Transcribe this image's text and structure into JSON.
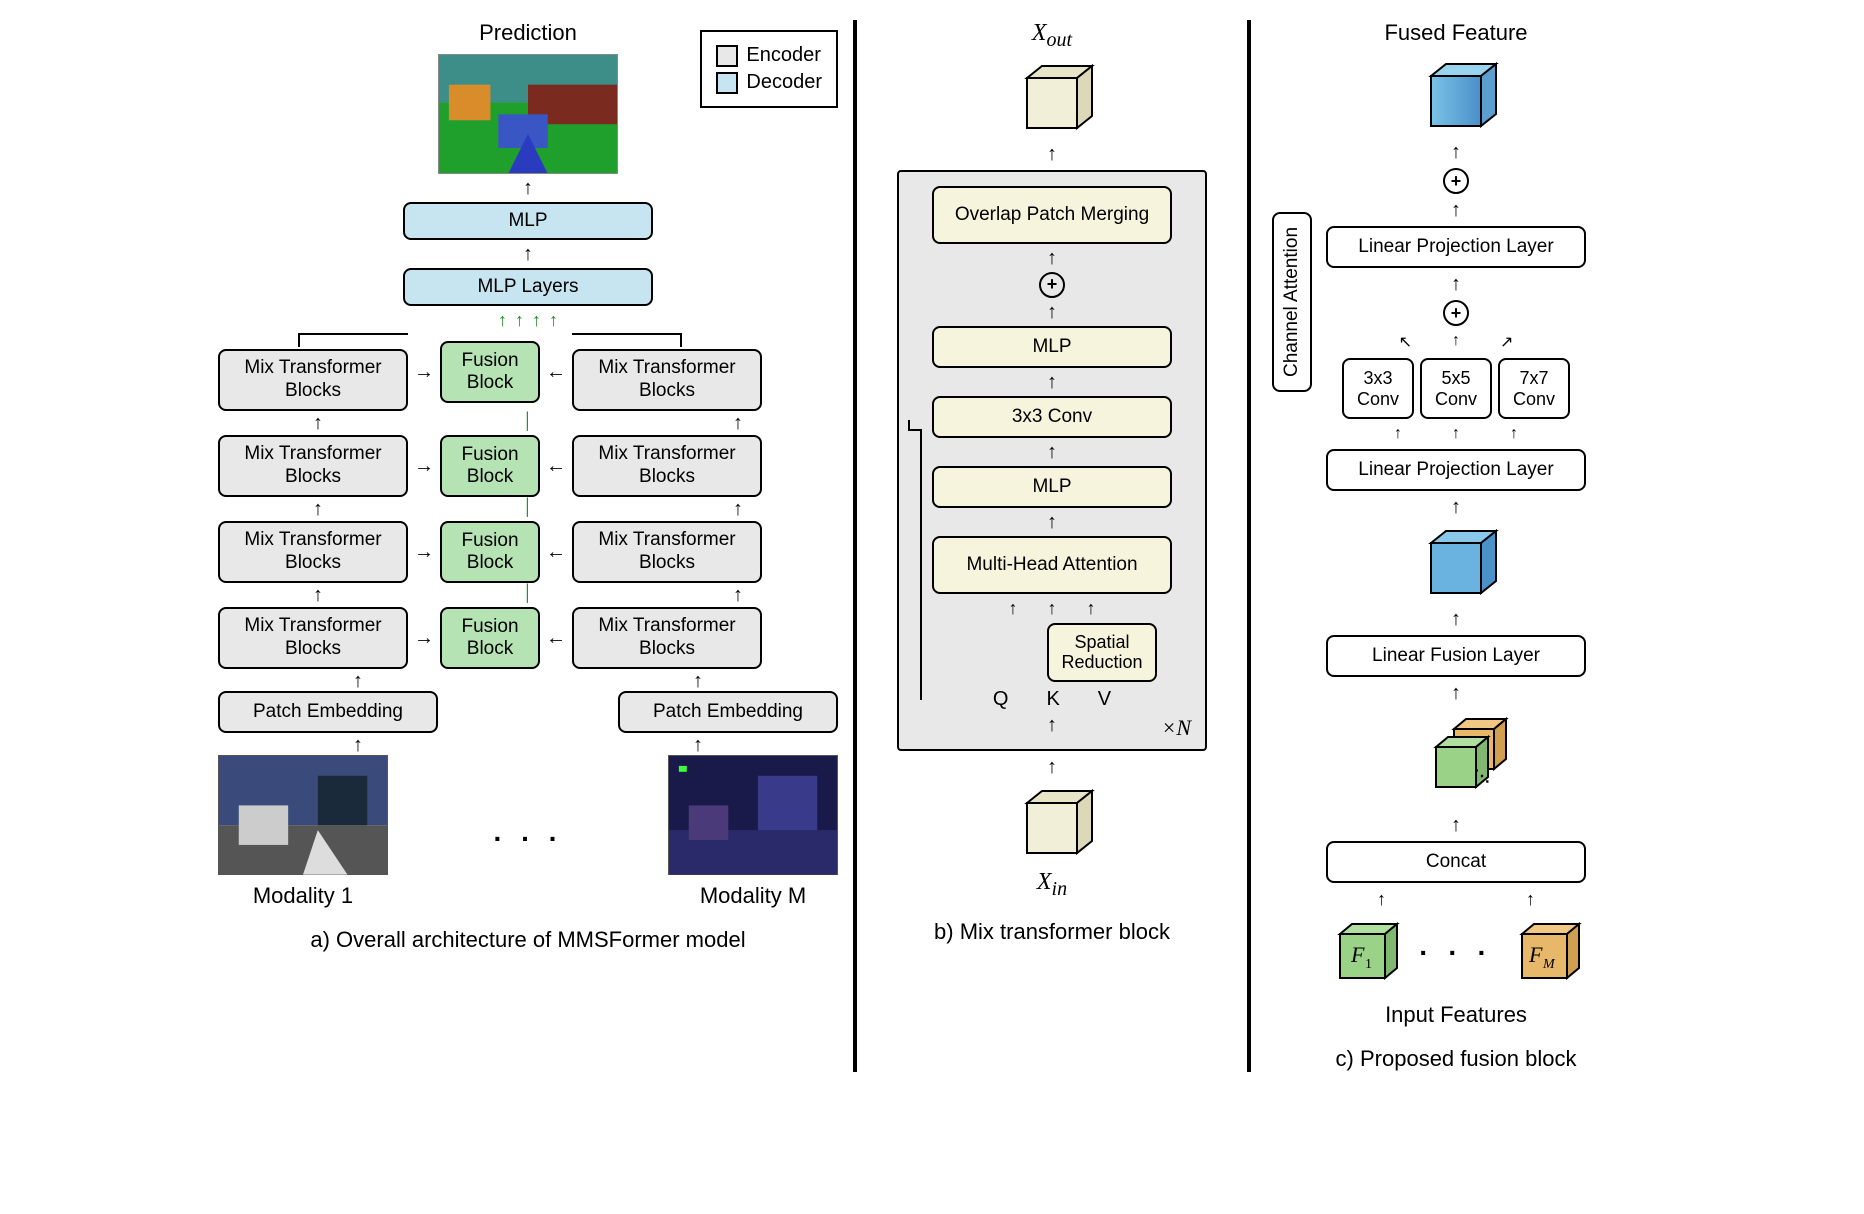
{
  "legend": {
    "encoder": "Encoder",
    "decoder": "Decoder"
  },
  "panelA": {
    "prediction": "Prediction",
    "mlp": "MLP",
    "mlpLayers": "MLP Layers",
    "fusion": "Fusion Block",
    "mixTransformer": "Mix Transformer Blocks",
    "patchEmbedding": "Patch Embedding",
    "modality1": "Modality 1",
    "modalityM": "Modality M",
    "caption": "a) Overall architecture of MMSFormer model"
  },
  "panelB": {
    "xout": "X",
    "xout_sub": "out",
    "xin": "X",
    "xin_sub": "in",
    "overlapPatch": "Overlap Patch Merging",
    "mlp": "MLP",
    "conv3x3": "3x3 Conv",
    "multiHead": "Multi-Head Attention",
    "spatialReduction": "Spatial Reduction",
    "q": "Q",
    "k": "K",
    "v": "V",
    "timesN": "×N",
    "caption": "b) Mix transformer block"
  },
  "panelC": {
    "fusedFeature": "Fused Feature",
    "linearProj": "Linear Projection Layer",
    "conv3x3": "3x3 Conv",
    "conv5x5": "5x5 Conv",
    "conv7x7": "7x7 Conv",
    "channelAttention": "Channel Attention",
    "linearFusion": "Linear Fusion Layer",
    "concat": "Concat",
    "f1": "F",
    "f1_sub": "1",
    "fm": "F",
    "fm_sub": "M",
    "inputFeatures": "Input Features",
    "caption": "c) Proposed fusion block"
  }
}
